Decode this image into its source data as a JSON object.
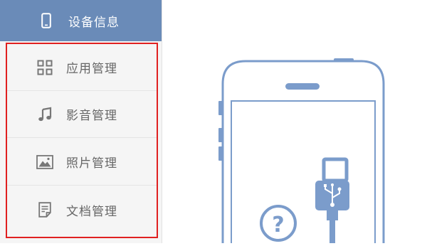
{
  "sidebar": {
    "header": {
      "label": "设备信息",
      "icon": "phone-icon"
    },
    "items": [
      {
        "label": "应用管理",
        "icon": "apps-grid-icon"
      },
      {
        "label": "影音管理",
        "icon": "music-note-icon"
      },
      {
        "label": "照片管理",
        "icon": "photo-icon"
      },
      {
        "label": "文档管理",
        "icon": "document-icon"
      }
    ]
  },
  "main": {
    "illustration": "phone-usb-illustration",
    "help_symbol": "?"
  },
  "colors": {
    "header_bg": "#6a8bb8",
    "highlight_border": "#e02020",
    "illustration_stroke": "#7b9ccb",
    "menu_text": "#666666"
  }
}
